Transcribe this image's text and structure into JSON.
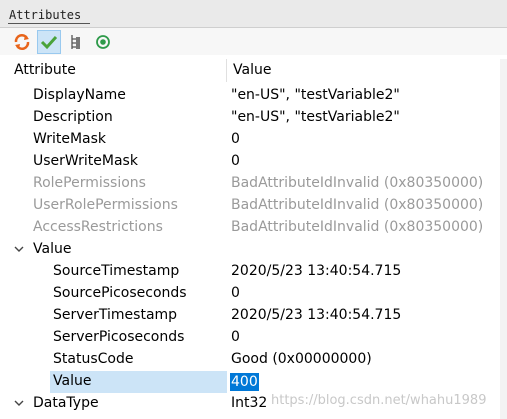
{
  "panel": {
    "title": "Attributes"
  },
  "toolbar": {
    "buttons": [
      {
        "icon": "refresh-icon"
      },
      {
        "icon": "check-icon"
      },
      {
        "icon": "tree-structure-icon"
      },
      {
        "icon": "target-icon"
      }
    ]
  },
  "table": {
    "header": {
      "attribute": "Attribute",
      "value": "Value"
    },
    "rows": [
      {
        "name": "DisplayName",
        "value": "\"en-US\", \"testVariable2\""
      },
      {
        "name": "Description",
        "value": "\"en-US\", \"testVariable2\""
      },
      {
        "name": "WriteMask",
        "value": "0"
      },
      {
        "name": "UserWriteMask",
        "value": "0"
      },
      {
        "name": "RolePermissions",
        "value": "BadAttributeIdInvalid (0x80350000)"
      },
      {
        "name": "UserRolePermissions",
        "value": "BadAttributeIdInvalid (0x80350000)"
      },
      {
        "name": "AccessRestrictions",
        "value": "BadAttributeIdInvalid (0x80350000)"
      },
      {
        "name": "Value",
        "value": ""
      },
      {
        "name": "SourceTimestamp",
        "value": "2020/5/23 13:40:54.715"
      },
      {
        "name": "SourcePicoseconds",
        "value": "0"
      },
      {
        "name": "ServerTimestamp",
        "value": "2020/5/23 13:40:54.715"
      },
      {
        "name": "ServerPicoseconds",
        "value": "0"
      },
      {
        "name": "StatusCode",
        "value": "Good (0x00000000)"
      },
      {
        "name": "Value",
        "value": "400"
      },
      {
        "name": "DataType",
        "value": "Int32"
      }
    ]
  },
  "watermark": "https://blog.csdn.net/whahu1989"
}
